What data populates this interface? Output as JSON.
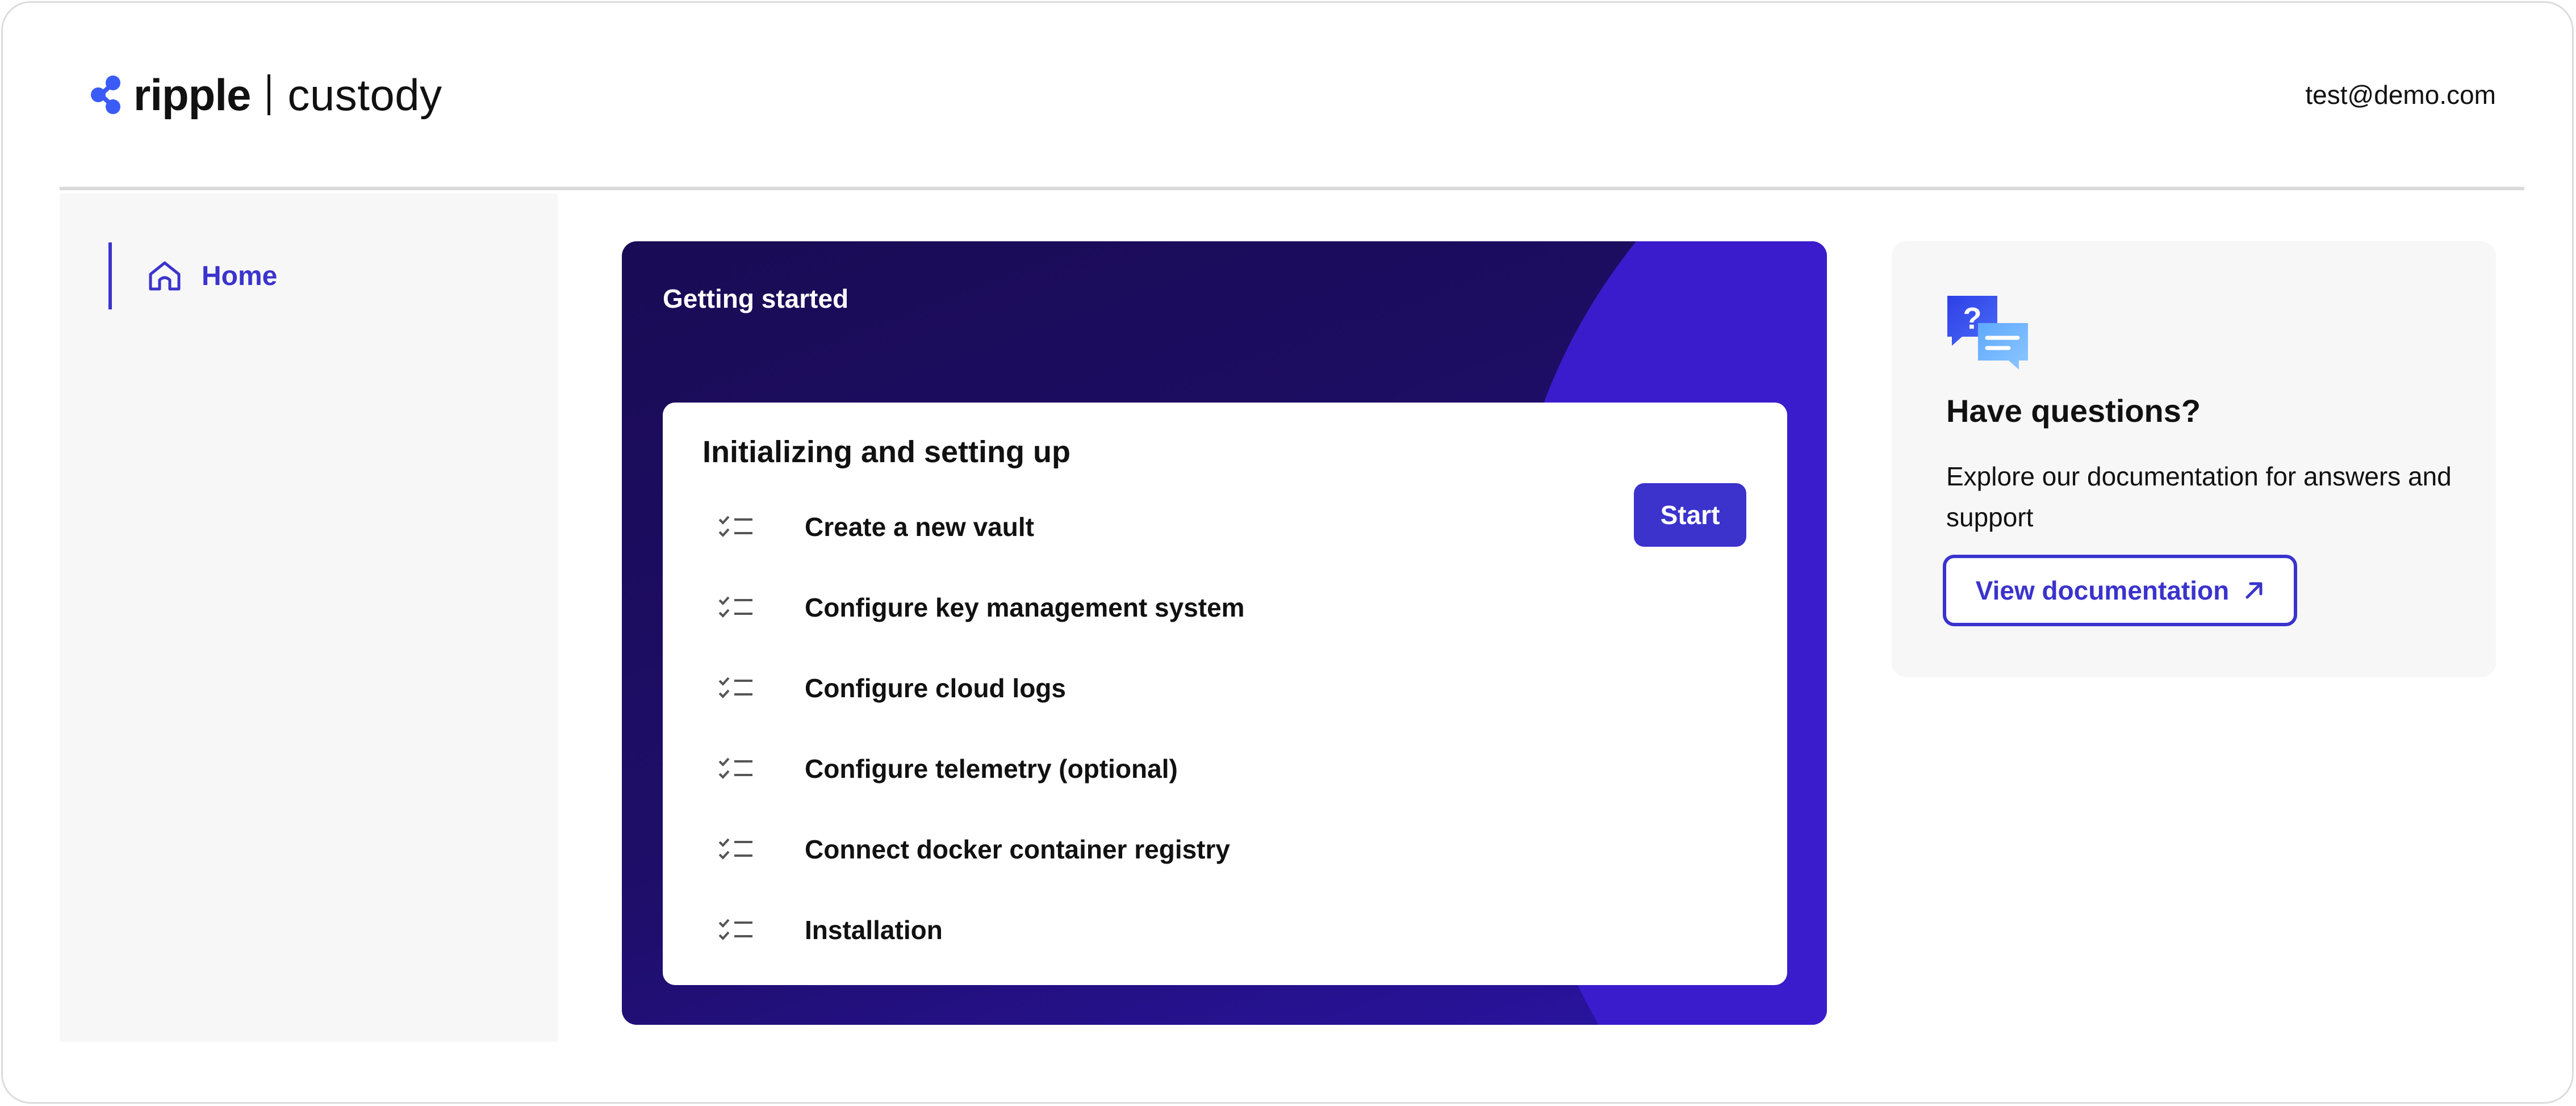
{
  "header": {
    "brand": "ripple",
    "product": "custody",
    "user_email": "test@demo.com"
  },
  "sidebar": {
    "items": [
      {
        "label": "Home",
        "icon": "home-icon",
        "active": true
      }
    ]
  },
  "getting_started": {
    "title": "Getting started",
    "section_title": "Initializing and setting up",
    "start_label": "Start",
    "tasks": [
      {
        "label": "Create a new vault",
        "icon": "checklist-icon"
      },
      {
        "label": "Configure key management system",
        "icon": "checklist-icon"
      },
      {
        "label": "Configure cloud logs",
        "icon": "checklist-icon"
      },
      {
        "label": "Configure telemetry (optional)",
        "icon": "checklist-icon"
      },
      {
        "label": "Connect docker container registry",
        "icon": "checklist-icon"
      },
      {
        "label": "Installation",
        "icon": "checklist-icon"
      }
    ]
  },
  "questions": {
    "icon": "chat-question-icon",
    "title": "Have questions?",
    "description": "Explore our documentation for answers and support",
    "button_label": "View documentation",
    "button_icon": "external-arrow-icon"
  },
  "colors": {
    "accent": "#3b33cc",
    "card_dark": "#1a0b55",
    "card_arc": "#3a1ccc",
    "panel_bg": "#f7f7f7",
    "logo_blue": "#3b5bf6"
  }
}
